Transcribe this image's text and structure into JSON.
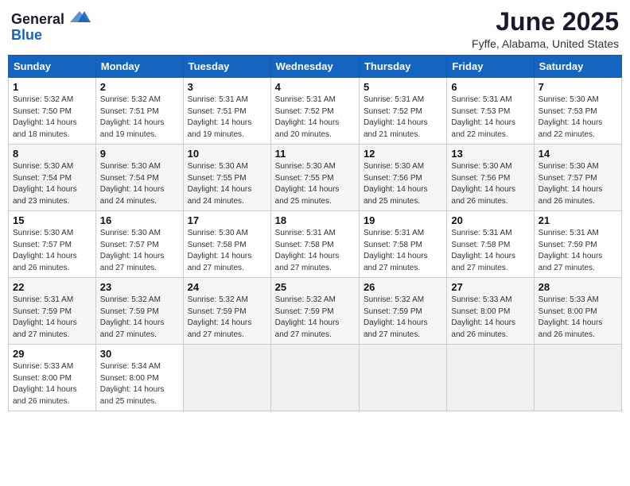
{
  "header": {
    "logo_general": "General",
    "logo_blue": "Blue",
    "month": "June 2025",
    "location": "Fyffe, Alabama, United States"
  },
  "weekdays": [
    "Sunday",
    "Monday",
    "Tuesday",
    "Wednesday",
    "Thursday",
    "Friday",
    "Saturday"
  ],
  "weeks": [
    [
      {
        "day": "1",
        "info": "Sunrise: 5:32 AM\nSunset: 7:50 PM\nDaylight: 14 hours\nand 18 minutes."
      },
      {
        "day": "2",
        "info": "Sunrise: 5:32 AM\nSunset: 7:51 PM\nDaylight: 14 hours\nand 19 minutes."
      },
      {
        "day": "3",
        "info": "Sunrise: 5:31 AM\nSunset: 7:51 PM\nDaylight: 14 hours\nand 19 minutes."
      },
      {
        "day": "4",
        "info": "Sunrise: 5:31 AM\nSunset: 7:52 PM\nDaylight: 14 hours\nand 20 minutes."
      },
      {
        "day": "5",
        "info": "Sunrise: 5:31 AM\nSunset: 7:52 PM\nDaylight: 14 hours\nand 21 minutes."
      },
      {
        "day": "6",
        "info": "Sunrise: 5:31 AM\nSunset: 7:53 PM\nDaylight: 14 hours\nand 22 minutes."
      },
      {
        "day": "7",
        "info": "Sunrise: 5:30 AM\nSunset: 7:53 PM\nDaylight: 14 hours\nand 22 minutes."
      }
    ],
    [
      {
        "day": "8",
        "info": "Sunrise: 5:30 AM\nSunset: 7:54 PM\nDaylight: 14 hours\nand 23 minutes."
      },
      {
        "day": "9",
        "info": "Sunrise: 5:30 AM\nSunset: 7:54 PM\nDaylight: 14 hours\nand 24 minutes."
      },
      {
        "day": "10",
        "info": "Sunrise: 5:30 AM\nSunset: 7:55 PM\nDaylight: 14 hours\nand 24 minutes."
      },
      {
        "day": "11",
        "info": "Sunrise: 5:30 AM\nSunset: 7:55 PM\nDaylight: 14 hours\nand 25 minutes."
      },
      {
        "day": "12",
        "info": "Sunrise: 5:30 AM\nSunset: 7:56 PM\nDaylight: 14 hours\nand 25 minutes."
      },
      {
        "day": "13",
        "info": "Sunrise: 5:30 AM\nSunset: 7:56 PM\nDaylight: 14 hours\nand 26 minutes."
      },
      {
        "day": "14",
        "info": "Sunrise: 5:30 AM\nSunset: 7:57 PM\nDaylight: 14 hours\nand 26 minutes."
      }
    ],
    [
      {
        "day": "15",
        "info": "Sunrise: 5:30 AM\nSunset: 7:57 PM\nDaylight: 14 hours\nand 26 minutes."
      },
      {
        "day": "16",
        "info": "Sunrise: 5:30 AM\nSunset: 7:57 PM\nDaylight: 14 hours\nand 27 minutes."
      },
      {
        "day": "17",
        "info": "Sunrise: 5:30 AM\nSunset: 7:58 PM\nDaylight: 14 hours\nand 27 minutes."
      },
      {
        "day": "18",
        "info": "Sunrise: 5:31 AM\nSunset: 7:58 PM\nDaylight: 14 hours\nand 27 minutes."
      },
      {
        "day": "19",
        "info": "Sunrise: 5:31 AM\nSunset: 7:58 PM\nDaylight: 14 hours\nand 27 minutes."
      },
      {
        "day": "20",
        "info": "Sunrise: 5:31 AM\nSunset: 7:58 PM\nDaylight: 14 hours\nand 27 minutes."
      },
      {
        "day": "21",
        "info": "Sunrise: 5:31 AM\nSunset: 7:59 PM\nDaylight: 14 hours\nand 27 minutes."
      }
    ],
    [
      {
        "day": "22",
        "info": "Sunrise: 5:31 AM\nSunset: 7:59 PM\nDaylight: 14 hours\nand 27 minutes."
      },
      {
        "day": "23",
        "info": "Sunrise: 5:32 AM\nSunset: 7:59 PM\nDaylight: 14 hours\nand 27 minutes."
      },
      {
        "day": "24",
        "info": "Sunrise: 5:32 AM\nSunset: 7:59 PM\nDaylight: 14 hours\nand 27 minutes."
      },
      {
        "day": "25",
        "info": "Sunrise: 5:32 AM\nSunset: 7:59 PM\nDaylight: 14 hours\nand 27 minutes."
      },
      {
        "day": "26",
        "info": "Sunrise: 5:32 AM\nSunset: 7:59 PM\nDaylight: 14 hours\nand 27 minutes."
      },
      {
        "day": "27",
        "info": "Sunrise: 5:33 AM\nSunset: 8:00 PM\nDaylight: 14 hours\nand 26 minutes."
      },
      {
        "day": "28",
        "info": "Sunrise: 5:33 AM\nSunset: 8:00 PM\nDaylight: 14 hours\nand 26 minutes."
      }
    ],
    [
      {
        "day": "29",
        "info": "Sunrise: 5:33 AM\nSunset: 8:00 PM\nDaylight: 14 hours\nand 26 minutes."
      },
      {
        "day": "30",
        "info": "Sunrise: 5:34 AM\nSunset: 8:00 PM\nDaylight: 14 hours\nand 25 minutes."
      },
      {
        "day": "",
        "info": ""
      },
      {
        "day": "",
        "info": ""
      },
      {
        "day": "",
        "info": ""
      },
      {
        "day": "",
        "info": ""
      },
      {
        "day": "",
        "info": ""
      }
    ]
  ]
}
